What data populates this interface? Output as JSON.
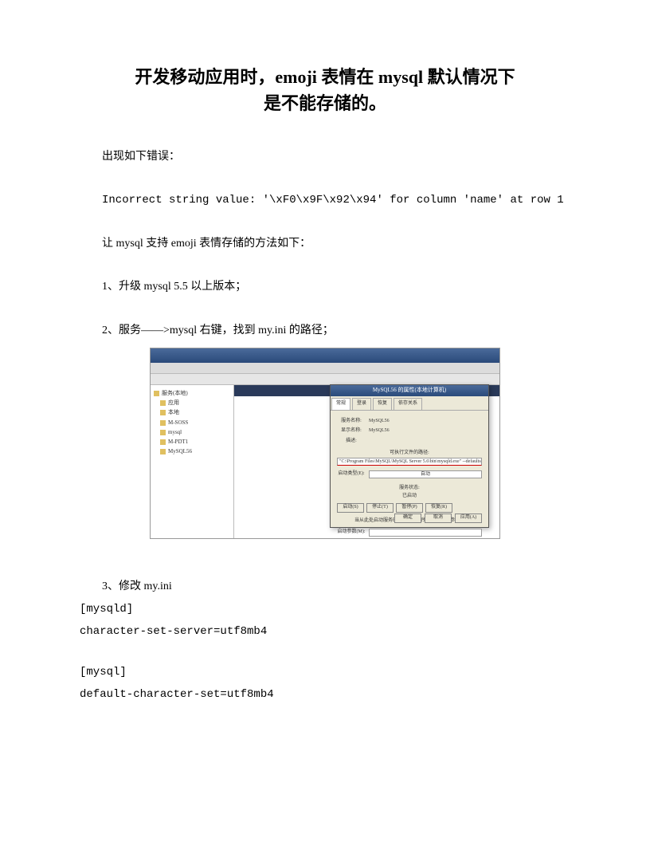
{
  "title_line1": "开发移动应用时，emoji 表情在 mysql 默认情况下",
  "title_line2": "是不能存储的。",
  "p1": "出现如下错误：",
  "p2": "Incorrect string value: '\\xF0\\x9F\\x92\\x94' for column 'name' at row 1",
  "p3": "让 mysql 支持 emoji 表情存储的方法如下：",
  "p4": "1、升级 mysql 5.5 以上版本；",
  "p5": "2、服务——>mysql 右键，找到 my.ini 的路径；",
  "p6": "3、修改 my.ini",
  "c1": "[mysqld]",
  "c2": "character-set-server=utf8mb4",
  "c3": "[mysql]",
  "c4": "default-character-set=utf8mb4",
  "ss": {
    "tree": [
      "服务(本地)",
      "应用",
      "本地",
      "M-SOSS",
      "mysql",
      "M-PDT1",
      "MySQL56"
    ],
    "dialog": {
      "title": "MySQL56 的属性(本地计算机)",
      "tabs": [
        "常规",
        "登录",
        "恢复",
        "依存关系"
      ],
      "fields": {
        "name": "服务名称:",
        "name_v": "MySQL56",
        "disp": "显示名称:",
        "disp_v": "MySQL56",
        "desc": "描述:",
        "path": "可执行文件的路径:",
        "path_v": "\"C:\\Program Files\\MySQL\\MySQL Server 5.6\\bin\\mysqld.exe\" --defaults-file=\"C:\\ProgramData\\MySQL\\my.ini\"",
        "type": "启动类型(E):",
        "type_v": "自动",
        "status": "服务状态:",
        "status_v": "已启动"
      },
      "buttons": [
        "确定",
        "取消",
        "应用(A)"
      ]
    }
  }
}
